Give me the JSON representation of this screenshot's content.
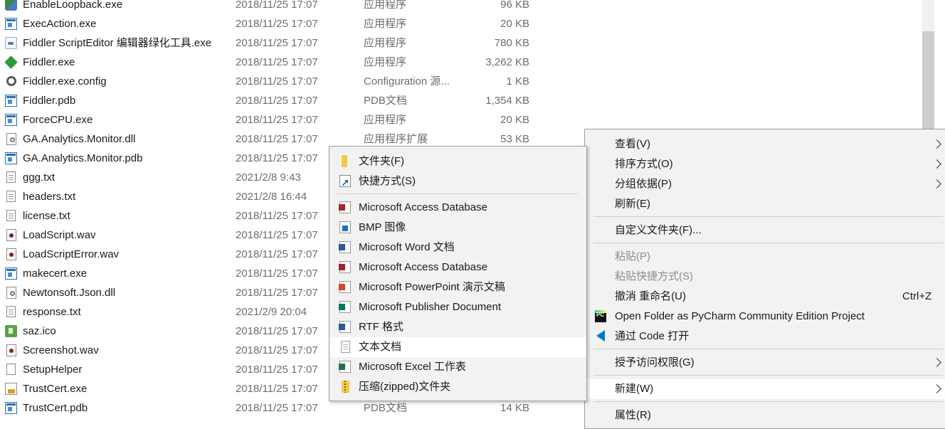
{
  "files": [
    {
      "name": "EnableLoopback.exe",
      "date": "2018/11/25 17:07",
      "type": "应用程序",
      "size": "96 KB",
      "icon": "loopback-icon"
    },
    {
      "name": "ExecAction.exe",
      "date": "2018/11/25 17:07",
      "type": "应用程序",
      "size": "20 KB",
      "icon": "exe-icon"
    },
    {
      "name": "Fiddler ScriptEditor 编辑器绿化工具.exe",
      "date": "2018/11/25 17:07",
      "type": "应用程序",
      "size": "780 KB",
      "icon": "script-editor-icon"
    },
    {
      "name": "Fiddler.exe",
      "date": "2018/11/25 17:07",
      "type": "应用程序",
      "size": "3,262 KB",
      "icon": "fiddler-icon"
    },
    {
      "name": "Fiddler.exe.config",
      "date": "2018/11/25 17:07",
      "type": "Configuration 源...",
      "size": "1 KB",
      "icon": "config-gear-icon"
    },
    {
      "name": "Fiddler.pdb",
      "date": "2018/11/25 17:07",
      "type": "PDB文档",
      "size": "1,354 KB",
      "icon": "pdb-icon"
    },
    {
      "name": "ForceCPU.exe",
      "date": "2018/11/25 17:07",
      "type": "应用程序",
      "size": "20 KB",
      "icon": "exe-icon"
    },
    {
      "name": "GA.Analytics.Monitor.dll",
      "date": "2018/11/25 17:07",
      "type": "应用程序扩展",
      "size": "53 KB",
      "icon": "dll-icon"
    },
    {
      "name": "GA.Analytics.Monitor.pdb",
      "date": "2018/11/25 17:07",
      "type": "",
      "size": "",
      "icon": "pdb-icon"
    },
    {
      "name": "ggg.txt",
      "date": "2021/2/8 9:43",
      "type": "",
      "size": "",
      "icon": "text-file-icon"
    },
    {
      "name": "headers.txt",
      "date": "2021/2/8 16:44",
      "type": "",
      "size": "",
      "icon": "text-file-icon"
    },
    {
      "name": "license.txt",
      "date": "2018/11/25 17:07",
      "type": "",
      "size": "",
      "icon": "text-file-icon"
    },
    {
      "name": "LoadScript.wav",
      "date": "2018/11/25 17:07",
      "type": "",
      "size": "",
      "icon": "wav-icon"
    },
    {
      "name": "LoadScriptError.wav",
      "date": "2018/11/25 17:07",
      "type": "",
      "size": "",
      "icon": "wav-icon"
    },
    {
      "name": "makecert.exe",
      "date": "2018/11/25 17:07",
      "type": "",
      "size": "",
      "icon": "exe-icon"
    },
    {
      "name": "Newtonsoft.Json.dll",
      "date": "2018/11/25 17:07",
      "type": "",
      "size": "",
      "icon": "dll-icon"
    },
    {
      "name": "response.txt",
      "date": "2021/2/9 20:04",
      "type": "",
      "size": "",
      "icon": "text-file-icon"
    },
    {
      "name": "saz.ico",
      "date": "2018/11/25 17:07",
      "type": "",
      "size": "",
      "icon": "saz-icon"
    },
    {
      "name": "Screenshot.wav",
      "date": "2018/11/25 17:07",
      "type": "",
      "size": "",
      "icon": "wav-icon"
    },
    {
      "name": "SetupHelper",
      "date": "2018/11/25 17:07",
      "type": "",
      "size": "",
      "icon": "blank-file-icon"
    },
    {
      "name": "TrustCert.exe",
      "date": "2018/11/25 17:07",
      "type": "",
      "size": "",
      "icon": "cert-icon"
    },
    {
      "name": "TrustCert.pdb",
      "date": "2018/11/25 17:07",
      "type": "PDB文档",
      "size": "14 KB",
      "icon": "pdb-icon"
    }
  ],
  "context_menu": {
    "view": "查看(V)",
    "sort_by": "排序方式(O)",
    "group_by": "分组依据(P)",
    "refresh": "刷新(E)",
    "customize_folder": "自定义文件夹(F)...",
    "paste": "粘贴(P)",
    "paste_shortcut": "粘贴快捷方式(S)",
    "undo_rename": "撤消 重命名(U)",
    "undo_shortcut": "Ctrl+Z",
    "open_pycharm": "Open Folder as PyCharm Community Edition Project",
    "open_vscode": "通过 Code 打开",
    "grant_access": "授予访问权限(G)",
    "new": "新建(W)",
    "properties": "属性(R)"
  },
  "new_submenu": {
    "folder": "文件夹(F)",
    "shortcut": "快捷方式(S)",
    "items": [
      {
        "label": "Microsoft Access Database",
        "icon": "access-icon"
      },
      {
        "label": "BMP 图像",
        "icon": "bmp-icon"
      },
      {
        "label": "Microsoft Word 文档",
        "icon": "word-icon"
      },
      {
        "label": "Microsoft Access Database",
        "icon": "access-icon"
      },
      {
        "label": "Microsoft PowerPoint 演示文稿",
        "icon": "powerpoint-icon"
      },
      {
        "label": "Microsoft Publisher Document",
        "icon": "publisher-icon"
      },
      {
        "label": "RTF 格式",
        "icon": "rtf-icon"
      },
      {
        "label": "文本文档",
        "icon": "text-document-icon"
      },
      {
        "label": "Microsoft Excel 工作表",
        "icon": "excel-icon"
      },
      {
        "label": "压缩(zipped)文件夹",
        "icon": "zip-folder-icon"
      }
    ],
    "highlighted_item": "文本文档"
  },
  "colors": {
    "menu_bg": "#f2f2f2",
    "menu_highlight": "#ffffff",
    "secondary_text": "#6d6d6d",
    "disabled_text": "#8d8d8d"
  }
}
